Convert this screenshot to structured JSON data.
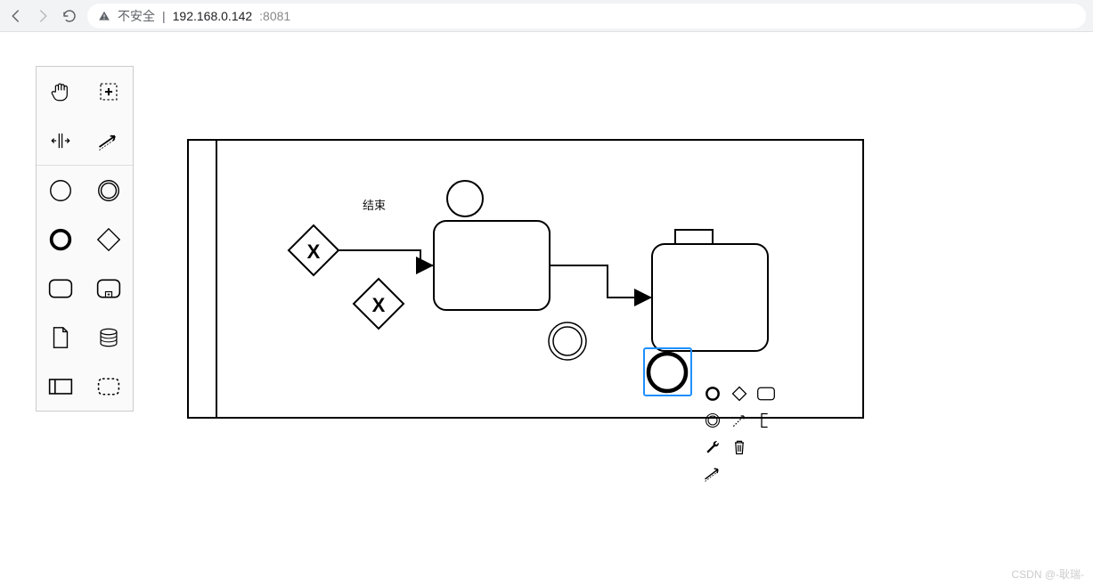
{
  "browser": {
    "insecure_label": "不安全",
    "address_host": "192.168.0.142",
    "address_port": ":8081"
  },
  "palette": {
    "items": [
      {
        "name": "hand-tool",
        "icon": "hand"
      },
      {
        "name": "lasso-tool",
        "icon": "lasso"
      },
      {
        "name": "space-tool",
        "icon": "space"
      },
      {
        "name": "connect-tool",
        "icon": "connect"
      },
      {
        "name": "start-event",
        "icon": "circle-thin"
      },
      {
        "name": "intermediate-event",
        "icon": "circle-double"
      },
      {
        "name": "end-event",
        "icon": "circle-thick"
      },
      {
        "name": "gateway",
        "icon": "diamond"
      },
      {
        "name": "task",
        "icon": "rounded-rect"
      },
      {
        "name": "subprocess",
        "icon": "subprocess"
      },
      {
        "name": "data-object",
        "icon": "page"
      },
      {
        "name": "data-store",
        "icon": "cylinder"
      },
      {
        "name": "participant",
        "icon": "rect"
      },
      {
        "name": "group",
        "icon": "dashed-rect"
      }
    ]
  },
  "diagram": {
    "lane_title": "",
    "labels": {
      "end_label": "结束"
    },
    "nodes": {
      "gateway1": {
        "letter": "X"
      },
      "gateway2": {
        "letter": "X"
      }
    }
  },
  "context_pad": {
    "items": [
      "end-event-icon",
      "gateway-icon",
      "task-icon",
      "intermediate-event-icon",
      "connect-dashed-icon",
      "text-annotation-icon",
      "wrench-icon",
      "trash-icon",
      "",
      "connect-arrow-icon",
      "",
      ""
    ]
  },
  "watermark": "CSDN @-耿瑞-"
}
